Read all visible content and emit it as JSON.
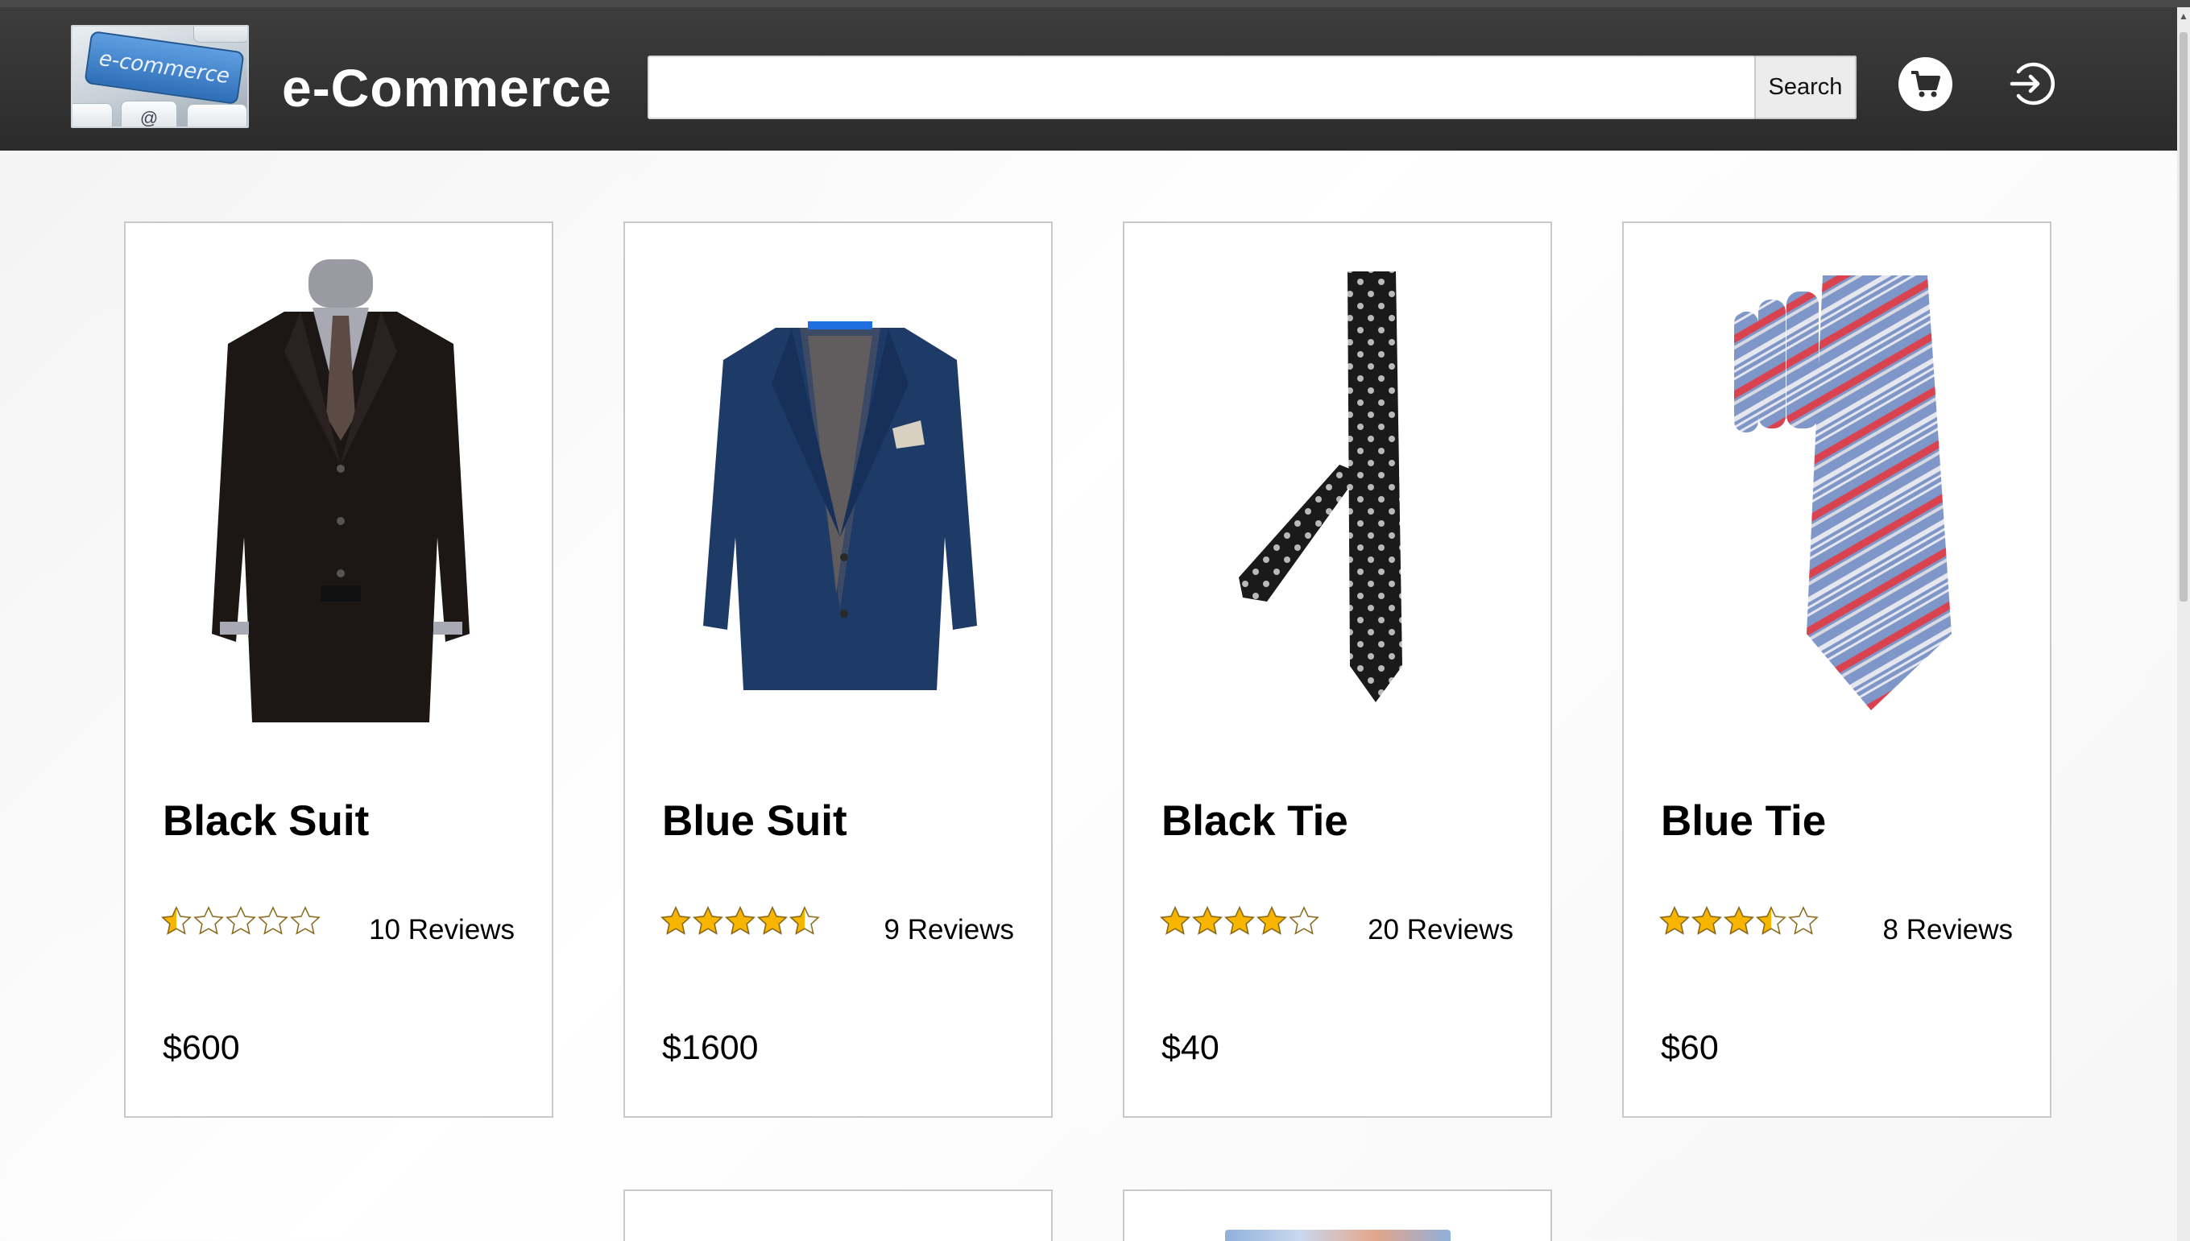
{
  "header": {
    "logo_text": "e-commerce",
    "brand": "e-Commerce",
    "search": {
      "value": "",
      "placeholder": "",
      "button_label": "Search"
    },
    "cart_icon": "cart-icon",
    "login_icon": "login-icon"
  },
  "colors": {
    "header_bg": "#2e2e2e",
    "star_fill": "#f7b500",
    "star_empty": "#ffffff",
    "card_border": "#c9c9c9"
  },
  "products": [
    {
      "name": "Black Suit",
      "rating": 0.5,
      "max_rating": 5,
      "reviews": "10 Reviews",
      "price": "$600",
      "image_icon": "black-suit-image"
    },
    {
      "name": "Blue Suit",
      "rating": 4.5,
      "max_rating": 5,
      "reviews": "9 Reviews",
      "price": "$1600",
      "image_icon": "blue-suit-image"
    },
    {
      "name": "Black Tie",
      "rating": 4,
      "max_rating": 5,
      "reviews": "20 Reviews",
      "price": "$40",
      "image_icon": "black-tie-image"
    },
    {
      "name": "Blue Tie",
      "rating": 3.5,
      "max_rating": 5,
      "reviews": "8 Reviews",
      "price": "$60",
      "image_icon": "blue-tie-image"
    }
  ]
}
